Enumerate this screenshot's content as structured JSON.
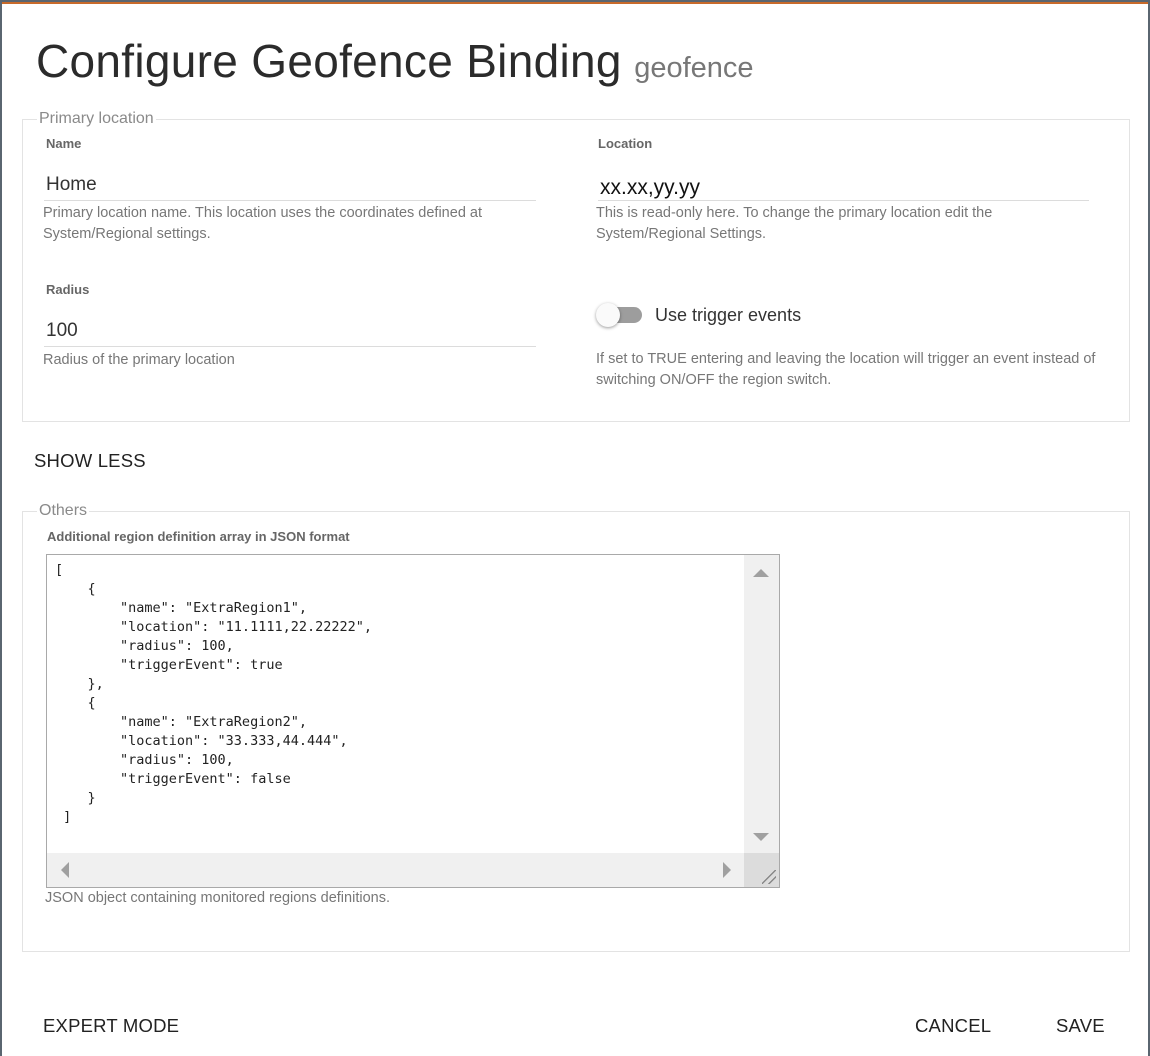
{
  "dialog": {
    "title": "Configure Geofence Binding",
    "subtitle": "geofence"
  },
  "primary": {
    "legend": "Primary location",
    "name": {
      "label": "Name",
      "value": "Home",
      "help": "Primary location name. This location uses the coordinates defined at System/Regional settings."
    },
    "location": {
      "label": "Location",
      "value": "xx.xx,yy.yy",
      "help": "This is read-only here. To change the primary location edit the System/Regional Settings."
    },
    "radius": {
      "label": "Radius",
      "value": "100",
      "help": "Radius of the primary location"
    },
    "trigger": {
      "label": "Use trigger events",
      "enabled": false,
      "help": "If set to TRUE entering and leaving the location will trigger an event instead of switching ON/OFF the region switch."
    }
  },
  "show_less_label": "SHOW LESS",
  "others": {
    "legend": "Others",
    "json_label": "Additional region definition array in JSON format",
    "json_value": "[\n    {\n        \"name\": \"ExtraRegion1\",\n        \"location\": \"11.1111,22.22222\",\n        \"radius\": 100,\n        \"triggerEvent\": true\n    },\n    {\n        \"name\": \"ExtraRegion2\",\n        \"location\": \"33.333,44.444\",\n        \"radius\": 100,\n        \"triggerEvent\": false\n    }\n ]",
    "json_help": "JSON object containing monitored regions definitions."
  },
  "footer": {
    "expert_mode_label": "EXPERT MODE",
    "cancel_label": "CANCEL",
    "save_label": "SAVE"
  },
  "colors": {
    "accent_border": "#c86a2a",
    "toggle_track": "#9d9d9d",
    "backdrop": "#5a6570"
  }
}
